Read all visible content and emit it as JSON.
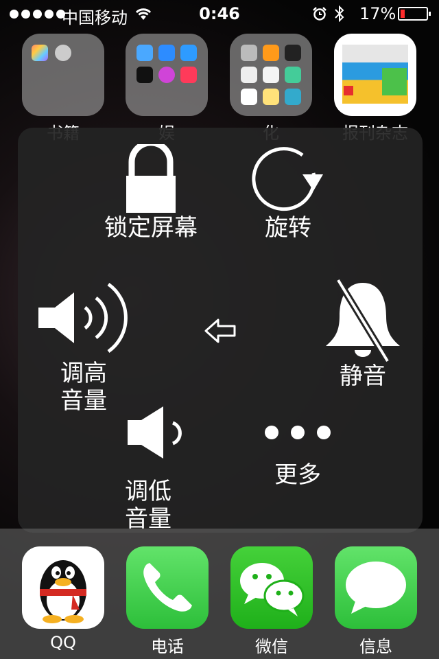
{
  "status_bar": {
    "signal_bars": 5,
    "carrier": "中国移动",
    "time": "0:46",
    "battery_percent_text": "17%",
    "battery_level": 0.17,
    "battery_color": "#ff2d2d",
    "icons": [
      "wifi-icon",
      "alarm-icon",
      "bluetooth-icon",
      "battery-icon"
    ]
  },
  "home_icons": [
    {
      "label": "书籍",
      "type": "folder"
    },
    {
      "label": "娱",
      "type": "folder"
    },
    {
      "label": "化",
      "type": "folder"
    },
    {
      "label": "报刊杂志",
      "type": "app"
    }
  ],
  "assistive_touch": {
    "lock_screen": "锁定屏幕",
    "rotate": "旋转",
    "volume_up_line1": "调高",
    "volume_up_line2": "音量",
    "mute": "静音",
    "volume_down_line1": "调低",
    "volume_down_line2": "音量",
    "more": "更多",
    "back_icon": "left-arrow-icon"
  },
  "dock": [
    {
      "label": "QQ",
      "color": "#ffffff"
    },
    {
      "label": "电话",
      "color": "#3ed64a"
    },
    {
      "label": "微信",
      "color": "#2fc12a"
    },
    {
      "label": "信息",
      "color": "#3ed64a"
    }
  ]
}
